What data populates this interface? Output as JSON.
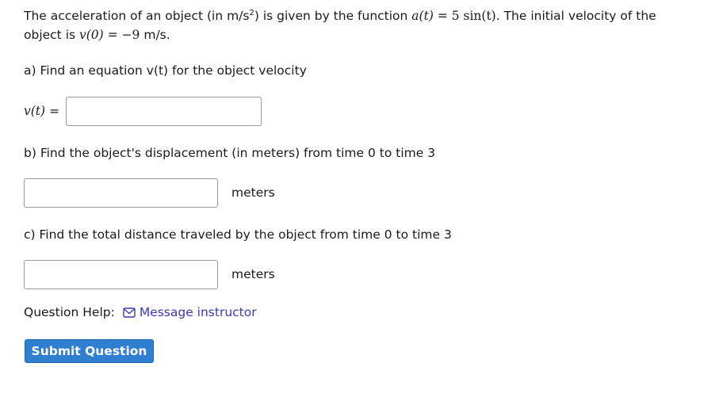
{
  "problem": {
    "intro_prefix": "The acceleration of an object (in ",
    "accel_unit": "m/s",
    "accel_unit_exp": "2",
    "intro_middle": ") is given by the function ",
    "function_lhs": "a(t)",
    "equals": " = ",
    "function_rhs": "5 sin(t)",
    "intro_suffix": ". The initial velocity of the",
    "line2_prefix": "object is ",
    "initial_lhs": "v(0)",
    "initial_rhs": "−9",
    "line2_suffix": " m/s."
  },
  "part_a": {
    "prompt": "a) Find an equation v(t) for the object velocity",
    "input_label": "v(t)",
    "input_label_eq": " =",
    "input_value": ""
  },
  "part_b": {
    "prompt": "b) Find the object's displacement (in meters) from time 0 to time 3",
    "input_value": "",
    "unit": "meters"
  },
  "part_c": {
    "prompt": "c) Find the total distance traveled by the object from time 0 to time 3",
    "input_value": "",
    "unit": "meters"
  },
  "help": {
    "label": "Question Help:",
    "link_label": "Message instructor",
    "link_icon": "mail-icon"
  },
  "submit": {
    "label": "Submit Question",
    "color": "#2f7fd1"
  }
}
